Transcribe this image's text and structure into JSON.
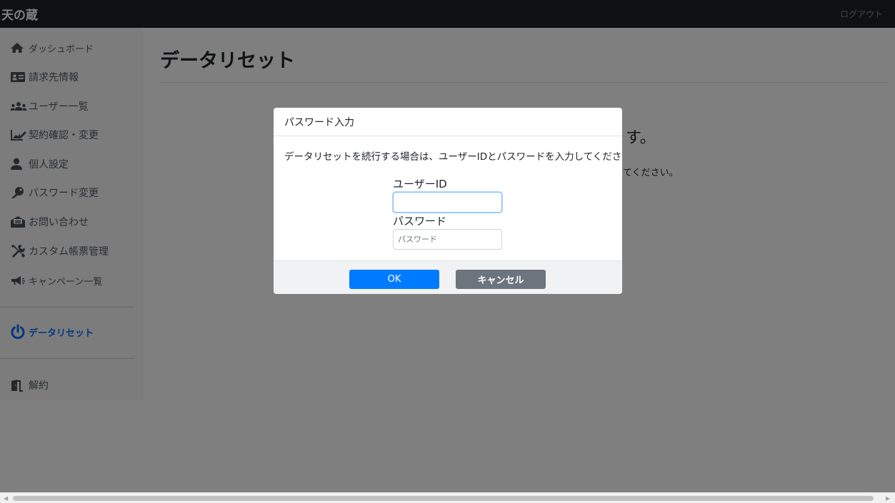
{
  "header": {
    "brand": "天の蔵",
    "logout": "ログアウト"
  },
  "sidebar": {
    "items": [
      {
        "label": "ダッシュボード",
        "icon": "home-icon"
      },
      {
        "label": "請求先情報",
        "icon": "id-card-icon"
      },
      {
        "label": "ユーザー一覧",
        "icon": "users-icon"
      },
      {
        "label": "契約確認・変更",
        "icon": "chart-edit-icon"
      },
      {
        "label": "個人設定",
        "icon": "user-icon"
      },
      {
        "label": "パスワード変更",
        "icon": "key-icon"
      },
      {
        "label": "お問い合わせ",
        "icon": "envelope-open-icon"
      },
      {
        "label": "カスタム帳票管理",
        "icon": "tools-icon"
      },
      {
        "label": "キャンペーン一覧",
        "icon": "megaphone-icon"
      },
      {
        "label": "データリセット",
        "icon": "power-icon"
      },
      {
        "label": "解約",
        "icon": "door-icon"
      }
    ],
    "accent_color": "#0d6efd"
  },
  "main": {
    "title": "データリセット",
    "bg_large_fragment": "す。",
    "bg_small_fragment": "てください。"
  },
  "modal": {
    "title": "パスワード入力",
    "message": "データリセットを続行する場合は、ユーザーIDとパスワードを入力してください。",
    "user_id_label": "ユーザーID",
    "user_id_value": "",
    "password_label": "パスワード",
    "password_placeholder": "パスワード",
    "ok_label": "OK",
    "cancel_label": "キャンセル",
    "ok_color": "#007bff",
    "cancel_color": "#6c757d"
  }
}
